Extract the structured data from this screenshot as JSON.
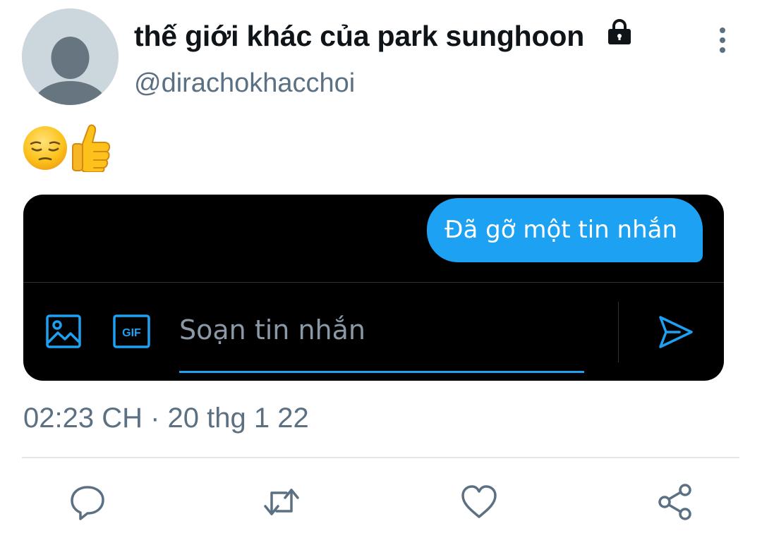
{
  "tweet": {
    "display_name": "thế giới khác của park sunghoon",
    "handle": "@dirachokhacchoi",
    "body_emojis": [
      "😔",
      "👍"
    ],
    "timestamp": "02:23 CH · 20 thg 1 22"
  },
  "dm_preview": {
    "message": "Đã gỡ một tin nhắn",
    "compose": {
      "placeholder": "Soạn tin nhắn",
      "gif_label": "GIF"
    }
  },
  "icons": {
    "avatar": "default-avatar",
    "protected": "lock-icon",
    "more": "more-vertical-icon",
    "attach_image": "image-icon",
    "attach_gif": "gif-icon",
    "send": "send-icon",
    "actions": [
      "reply-icon",
      "retweet-icon",
      "like-icon",
      "share-icon"
    ]
  },
  "colors": {
    "accent": "#1da1f2",
    "secondary_text": "#5b7083",
    "card_background": "#000000",
    "action_icon": "#5b7083"
  }
}
